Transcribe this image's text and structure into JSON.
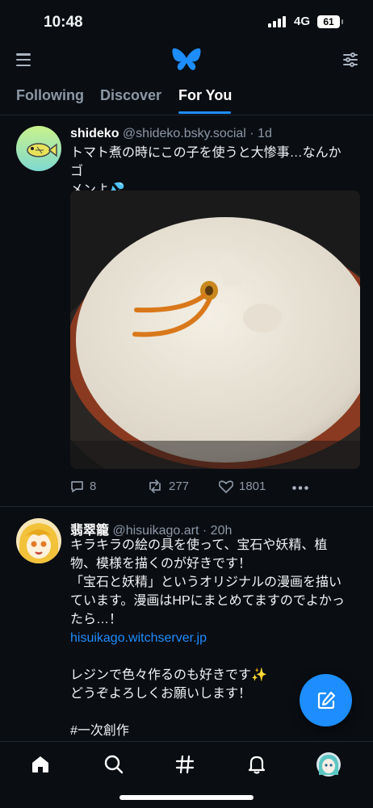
{
  "status_bar": {
    "time": "10:48",
    "network": "4G",
    "battery": "61"
  },
  "header": {
    "menu_icon": "hamburger-menu-icon",
    "logo": "butterfly-logo",
    "filter_icon": "sliders-icon"
  },
  "tabs": [
    {
      "label": "Following",
      "active": false
    },
    {
      "label": "Discover",
      "active": false
    },
    {
      "label": "For You",
      "active": true
    }
  ],
  "posts": [
    {
      "name": "shideko",
      "handle": "@shideko.bsky.social",
      "time": "· 1d",
      "text_lines": [
        "トマト煮の時にこの子を使うと大惨事…なんかゴ",
        "メンよ💦"
      ],
      "image": "photo of pot lid shaped like a creature on a pan",
      "replies": "8",
      "reposts": "277",
      "likes": "1801"
    },
    {
      "name": "翡翠籠",
      "handle": "@hisuikago.art",
      "time": "· 20h",
      "text_lines": [
        "キラキラの絵の具を使って、宝石や妖精、植",
        "物、模様を描くのが好きです！",
        "「宝石と妖精」というオリジナルの漫画を描い",
        "ています。漫画はHPにまとめてますのでよかっ",
        "たら…！"
      ],
      "link": "hisuikago.witchserver.jp",
      "text_lines_2": [
        "レジンで色々作るのも好きです✨",
        "どうぞよろしくお願いします！"
      ],
      "tag_line": "#一次創作"
    }
  ],
  "fab": {
    "icon": "compose-icon"
  },
  "bottom_nav": [
    {
      "icon": "home-icon",
      "active": true
    },
    {
      "icon": "search-icon"
    },
    {
      "icon": "hashtag-icon"
    },
    {
      "icon": "bell-icon"
    },
    {
      "icon": "profile-avatar"
    }
  ],
  "colors": {
    "accent": "#1d8dff",
    "background": "#0a0d12",
    "muted": "#8c98a6"
  }
}
